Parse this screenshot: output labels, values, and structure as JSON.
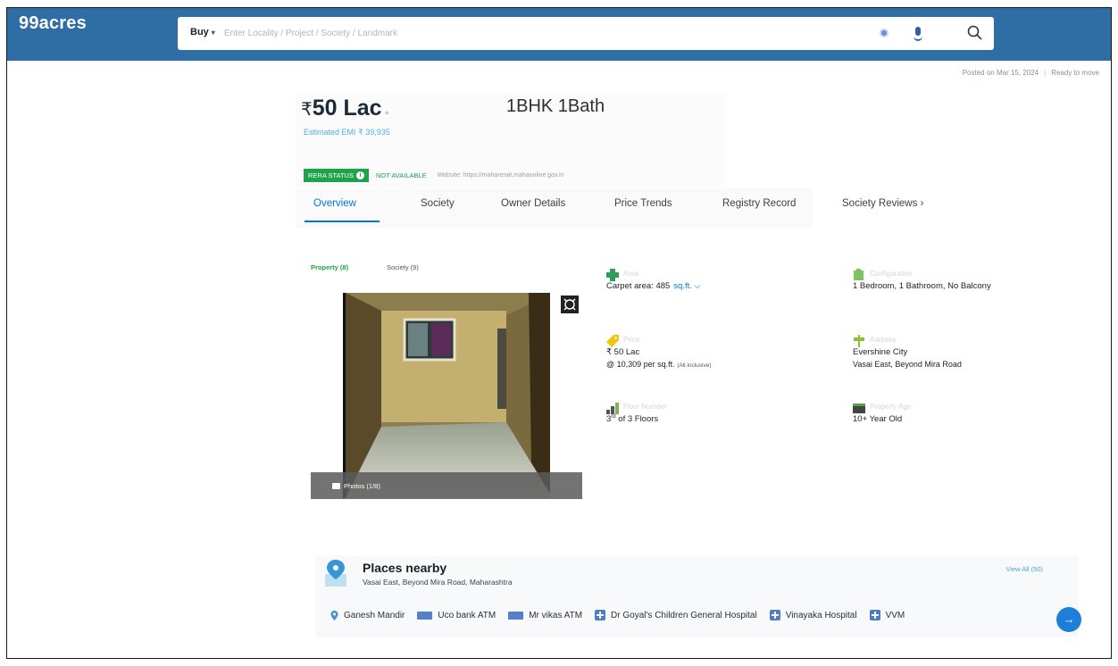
{
  "header": {
    "logo": "99acres",
    "buy_label": "Buy",
    "search_placeholder": "Enter Locality / Project / Society / Landmark",
    "icons": [
      "location-icon",
      "mic-icon",
      "search-icon"
    ]
  },
  "listing_meta": {
    "posted": "Posted on Mar 15, 2024",
    "status": "Ready to move"
  },
  "price_card": {
    "rupee": "₹",
    "price": "50 Lac",
    "price_note": "",
    "emi": "Estimated EMI ₹ 39,935",
    "bhk": "1BHK 1Bath",
    "rera_label": "RERA STATUS",
    "rera_value": "NOT AVAILABLE",
    "rera_website": "Website: https://maharerait.mahaonline.gov.in"
  },
  "tabs": [
    "Overview",
    "Society",
    "Owner Details",
    "Price Trends",
    "Registry Record",
    "Society Reviews"
  ],
  "tabs_more": "›",
  "gallery": {
    "tab_property": "Property (8)",
    "tab_society": "Society (9)",
    "photo_count": "Photos (1/8)"
  },
  "details": {
    "area": {
      "label": "Area",
      "value": "Carpet area: 485",
      "unit": "sq.ft."
    },
    "configuration": {
      "label": "Configuration",
      "value": "1 Bedroom, 1 Bathroom, No Balcony"
    },
    "price": {
      "label": "Price",
      "value": "₹ 50 Lac",
      "rate": "@ 10,309 per sq.ft.",
      "rate_note": "(All inclusive)"
    },
    "address": {
      "label": "Address",
      "line1": "Evershine City",
      "line2": "Vasai East, Beyond Mira Road"
    },
    "floor": {
      "label": "Floor Number",
      "value_prefix": "3",
      "value_sup": "rd",
      "value_suffix": " of 3 Floors"
    },
    "age": {
      "label": "Property Age",
      "value": "10+ Year Old"
    }
  },
  "places": {
    "title": "Places nearby",
    "subtitle": "Vasai East, Beyond Mira Road, Maharashtra",
    "view_all": "View All (50)",
    "items": [
      {
        "icon": "pin-icon",
        "label": "Ganesh Mandir"
      },
      {
        "icon": "atm-icon",
        "label": "Uco bank ATM"
      },
      {
        "icon": "atm-icon",
        "label": "Mr vikas ATM"
      },
      {
        "icon": "hospital-icon",
        "label": "Dr Goyal's Children General Hospital"
      },
      {
        "icon": "hospital-icon",
        "label": "Vinayaka Hospital"
      },
      {
        "icon": "hospital-icon",
        "label": "VVM"
      }
    ],
    "next": "→"
  },
  "colors": {
    "header_bg": "#2f6ea4",
    "accent": "#0078db",
    "green": "#1fa34a"
  }
}
